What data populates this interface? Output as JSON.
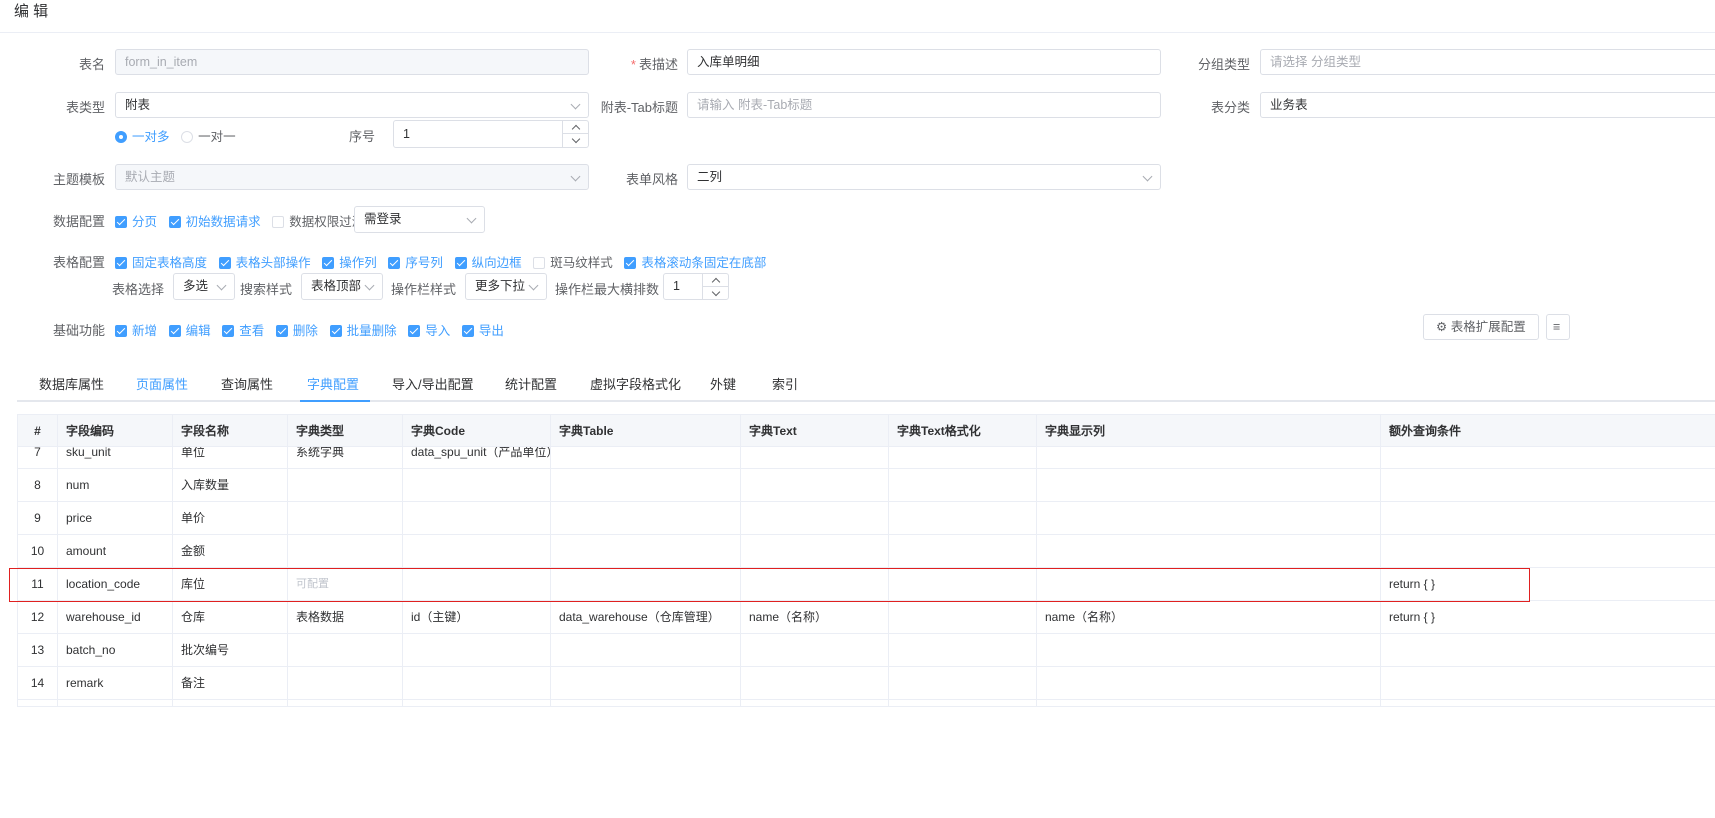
{
  "header": {
    "title": "编 辑"
  },
  "form": {
    "table_name": {
      "label": "表名",
      "value": "form_in_item"
    },
    "table_desc": {
      "label": "表描述",
      "value": "入库单明细"
    },
    "group_type": {
      "label": "分组类型",
      "placeholder": "请选择 分组类型"
    },
    "table_type": {
      "label": "表类型",
      "value": "附表"
    },
    "sub_tab_title": {
      "label": "附表-Tab标题",
      "placeholder": "请输入 附表-Tab标题"
    },
    "table_category": {
      "label": "表分类",
      "value": "业务表"
    },
    "relation": {
      "options": [
        "一对多",
        "一对一"
      ],
      "selected": "一对多"
    },
    "seq": {
      "label": "序号",
      "value": "1"
    },
    "theme": {
      "label": "主题模板",
      "value": "默认主题"
    },
    "form_style": {
      "label": "表单风格",
      "value": "二列"
    },
    "data_config": {
      "label": "数据配置",
      "options": [
        {
          "label": "分页",
          "checked": true
        },
        {
          "label": "初始数据请求",
          "checked": true
        },
        {
          "label": "数据权限过滤",
          "checked": false
        }
      ],
      "select": "需登录"
    },
    "table_config": {
      "label": "表格配置",
      "options": [
        {
          "label": "固定表格高度",
          "checked": true
        },
        {
          "label": "表格头部操作",
          "checked": true
        },
        {
          "label": "操作列",
          "checked": true
        },
        {
          "label": "序号列",
          "checked": true
        },
        {
          "label": "纵向边框",
          "checked": true
        },
        {
          "label": "斑马纹样式",
          "checked": false
        },
        {
          "label": "表格滚动条固定在底部",
          "checked": true
        }
      ],
      "table_select": {
        "label": "表格选择",
        "value": "多选"
      },
      "search_style": {
        "label": "搜索样式",
        "value": "表格顶部"
      },
      "action_style": {
        "label": "操作栏样式",
        "value": "更多下拉"
      },
      "action_max": {
        "label": "操作栏最大横排数",
        "value": "1"
      }
    },
    "basic_func": {
      "label": "基础功能",
      "options": [
        {
          "label": "新增",
          "checked": true
        },
        {
          "label": "编辑",
          "checked": true
        },
        {
          "label": "查看",
          "checked": true
        },
        {
          "label": "删除",
          "checked": true
        },
        {
          "label": "批量删除",
          "checked": true
        },
        {
          "label": "导入",
          "checked": true
        },
        {
          "label": "导出",
          "checked": true
        }
      ]
    },
    "ext_button": "表格扩展配置",
    "ext_button2": "≡"
  },
  "tabs": [
    {
      "label": "数据库属性"
    },
    {
      "label": "页面属性"
    },
    {
      "label": "查询属性"
    },
    {
      "label": "字典配置"
    },
    {
      "label": "导入/导出配置"
    },
    {
      "label": "统计配置"
    },
    {
      "label": "虚拟字段格式化"
    },
    {
      "label": "外键"
    },
    {
      "label": "索引"
    }
  ],
  "active_tab": "字典配置",
  "table": {
    "columns": [
      "#",
      "字段编码",
      "字段名称",
      "字典类型",
      "字典Code",
      "字典Table",
      "字典Text",
      "字典Text格式化",
      "字典显示列",
      "额外查询条件"
    ],
    "rows": [
      [
        "7",
        "sku_unit",
        "单位",
        "系统字典",
        "data_spu_unit（产品单位）",
        "",
        "",
        "",
        "",
        ""
      ],
      [
        "8",
        "num",
        "入库数量",
        "",
        "",
        "",
        "",
        "",
        "",
        ""
      ],
      [
        "9",
        "price",
        "单价",
        "",
        "",
        "",
        "",
        "",
        "",
        ""
      ],
      [
        "10",
        "amount",
        "金额",
        "",
        "",
        "",
        "",
        "",
        "",
        ""
      ],
      [
        "11",
        "location_code",
        "库位",
        "可配置",
        "",
        "",
        "",
        "",
        "",
        "return { }"
      ],
      [
        "12",
        "warehouse_id",
        "仓库",
        "表格数据",
        "id（主键）",
        "data_warehouse（仓库管理）",
        "name（名称）",
        "",
        "name（名称）",
        "return { }"
      ],
      [
        "13",
        "batch_no",
        "批次编号",
        "",
        "",
        "",
        "",
        "",
        "",
        ""
      ],
      [
        "14",
        "remark",
        "备注",
        "",
        "",
        "",
        "",
        "",
        "",
        ""
      ],
      [
        "",
        "",
        "",
        "",
        "",
        "",
        "",
        "",
        "",
        ""
      ]
    ]
  }
}
